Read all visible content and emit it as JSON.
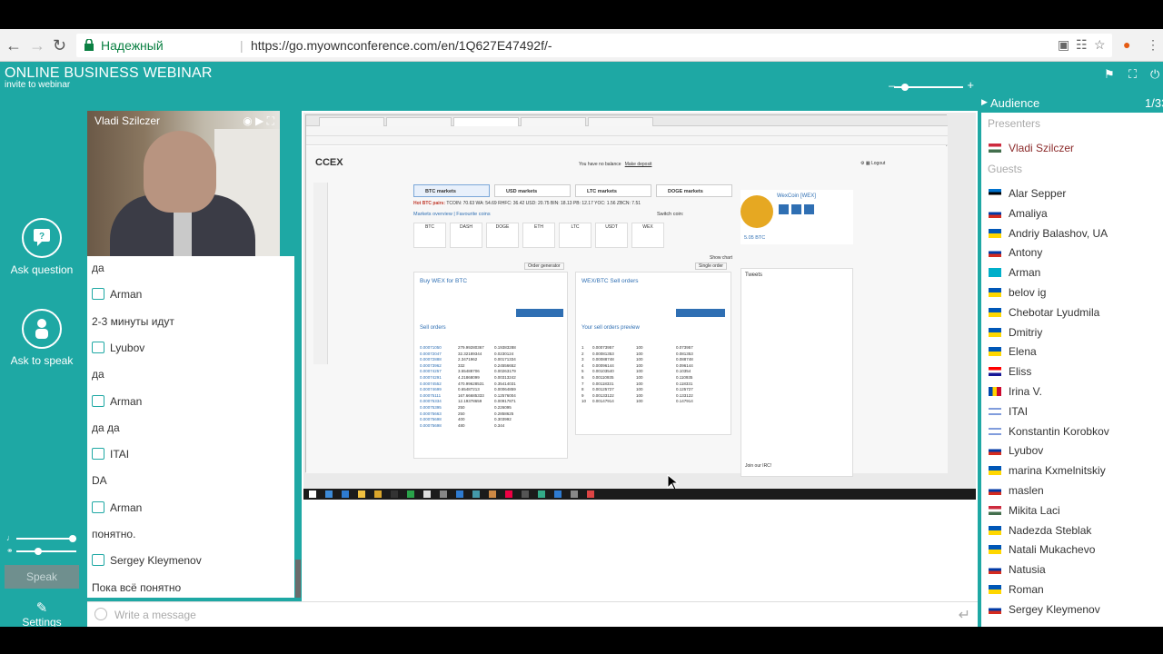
{
  "browser": {
    "secure_label": "Надежный",
    "url": "https://go.myownconference.com/en/1Q627E47492f/-"
  },
  "app": {
    "title": "ONLINE BUSINESS WEBINAR",
    "subtitle": "invite to webinar"
  },
  "left_actions": {
    "ask_question": "Ask question",
    "ask_to_speak": "Ask to speak",
    "speak": "Speak",
    "settings": "Settings"
  },
  "video": {
    "presenter_name": "Vladi Szilczer"
  },
  "chat": {
    "messages": [
      {
        "kind": "text",
        "text": "да"
      },
      {
        "kind": "user",
        "text": "Arman"
      },
      {
        "kind": "text",
        "text": "2-3 минуты идут"
      },
      {
        "kind": "user",
        "text": "Lyubov"
      },
      {
        "kind": "text",
        "text": "да"
      },
      {
        "kind": "user",
        "text": "Arman"
      },
      {
        "kind": "text",
        "text": "да да"
      },
      {
        "kind": "user",
        "text": "ITAI"
      },
      {
        "kind": "text",
        "text": "DA"
      },
      {
        "kind": "user",
        "text": "Arman"
      },
      {
        "kind": "text",
        "text": "понятно."
      },
      {
        "kind": "user",
        "text": "Sergey Kleymenov"
      },
      {
        "kind": "text",
        "text": "Пока всё понятно"
      }
    ],
    "input_placeholder": "Write a message"
  },
  "audience": {
    "title": "Audience",
    "count": "1/33",
    "presenters_label": "Presenters",
    "guests_label": "Guests",
    "presenters": [
      {
        "name": "Vladi Szilczer",
        "flag": "hungary"
      }
    ],
    "guests": [
      {
        "name": "Alar Sepper",
        "flag": "estonia"
      },
      {
        "name": "Amaliya",
        "flag": "russia"
      },
      {
        "name": "Andriy Balashov, UA",
        "flag": "ukraine"
      },
      {
        "name": "Antony",
        "flag": "russia"
      },
      {
        "name": "Arman",
        "flag": "kazakhstan"
      },
      {
        "name": "belov ig",
        "flag": "ukraine"
      },
      {
        "name": "Chebotar Lyudmila",
        "flag": "ukraine"
      },
      {
        "name": "Dmitriy",
        "flag": "ukraine"
      },
      {
        "name": "Elena",
        "flag": "ukraine"
      },
      {
        "name": "Eliss",
        "flag": "croatia"
      },
      {
        "name": "Irina V.",
        "flag": "moldova"
      },
      {
        "name": "ITAI",
        "flag": "israel"
      },
      {
        "name": "Konstantin Korobkov",
        "flag": "israel"
      },
      {
        "name": "Lyubov",
        "flag": "russia"
      },
      {
        "name": "marina Kxmelnitskiy",
        "flag": "ukraine"
      },
      {
        "name": "maslen",
        "flag": "russia"
      },
      {
        "name": "Mikita Laci",
        "flag": "hungary"
      },
      {
        "name": "Nadezda Steblak",
        "flag": "ukraine"
      },
      {
        "name": "Natali Mukachevo",
        "flag": "ukraine"
      },
      {
        "name": "Natusia",
        "flag": "russia"
      },
      {
        "name": "Roman",
        "flag": "ukraine"
      },
      {
        "name": "Sergey Kleymenov",
        "flag": "russia"
      }
    ]
  },
  "shared_screen": {
    "site_logo": "CCEX",
    "balance_text": "You have no balance",
    "deposit_link": "Make deposit",
    "markets": [
      "BTC markets",
      "USD markets",
      "LTC markets",
      "DOGE markets"
    ],
    "hot_pairs_label": "Hot BTC pairs:",
    "hot_pairs": "TCOIN: 70.63  WA: 54.69  RHFC: 36.42  USD: 20.75  BIN: 18.13  PB: 12.17  YOC: 1.56  ZBCN: 7.51",
    "overview_links": "Markets overview | Favourite coins",
    "switch_coin": "Switch coin:",
    "coin_tabs": [
      "BTC",
      "DASH",
      "DOGE",
      "ETH",
      "LTC",
      "USDT",
      "WEX"
    ],
    "buy_title": "Buy WEX for BTC",
    "sell_title": "WEX/BTC Sell orders",
    "sell_orders_label": "Sell orders",
    "preview_label": "Your sell orders preview",
    "order_generator": "Order generator",
    "show_chart": "Show chart",
    "single_order": "Single order",
    "wex_name": "WexCoin [WEX]",
    "wex_volume": "5.05 BTC",
    "tweets_title": "Tweets",
    "irc_label": "Join our IRC!"
  },
  "colors": {
    "app_teal": "#1ea8a4",
    "presenter_name": "#8b2a2a",
    "secure_green": "#0b8043"
  },
  "icons": {
    "browser": [
      "back-arrow-icon",
      "forward-arrow-icon",
      "reload-icon",
      "lock-icon",
      "translate-icon",
      "star-icon",
      "extension-icon",
      "menu-icon"
    ],
    "app": [
      "chat-question-icon",
      "hand-raise-icon",
      "settings-wrench-icon",
      "fullscreen-icon",
      "power-icon",
      "smile-icon",
      "enter-icon",
      "user-icon"
    ]
  }
}
